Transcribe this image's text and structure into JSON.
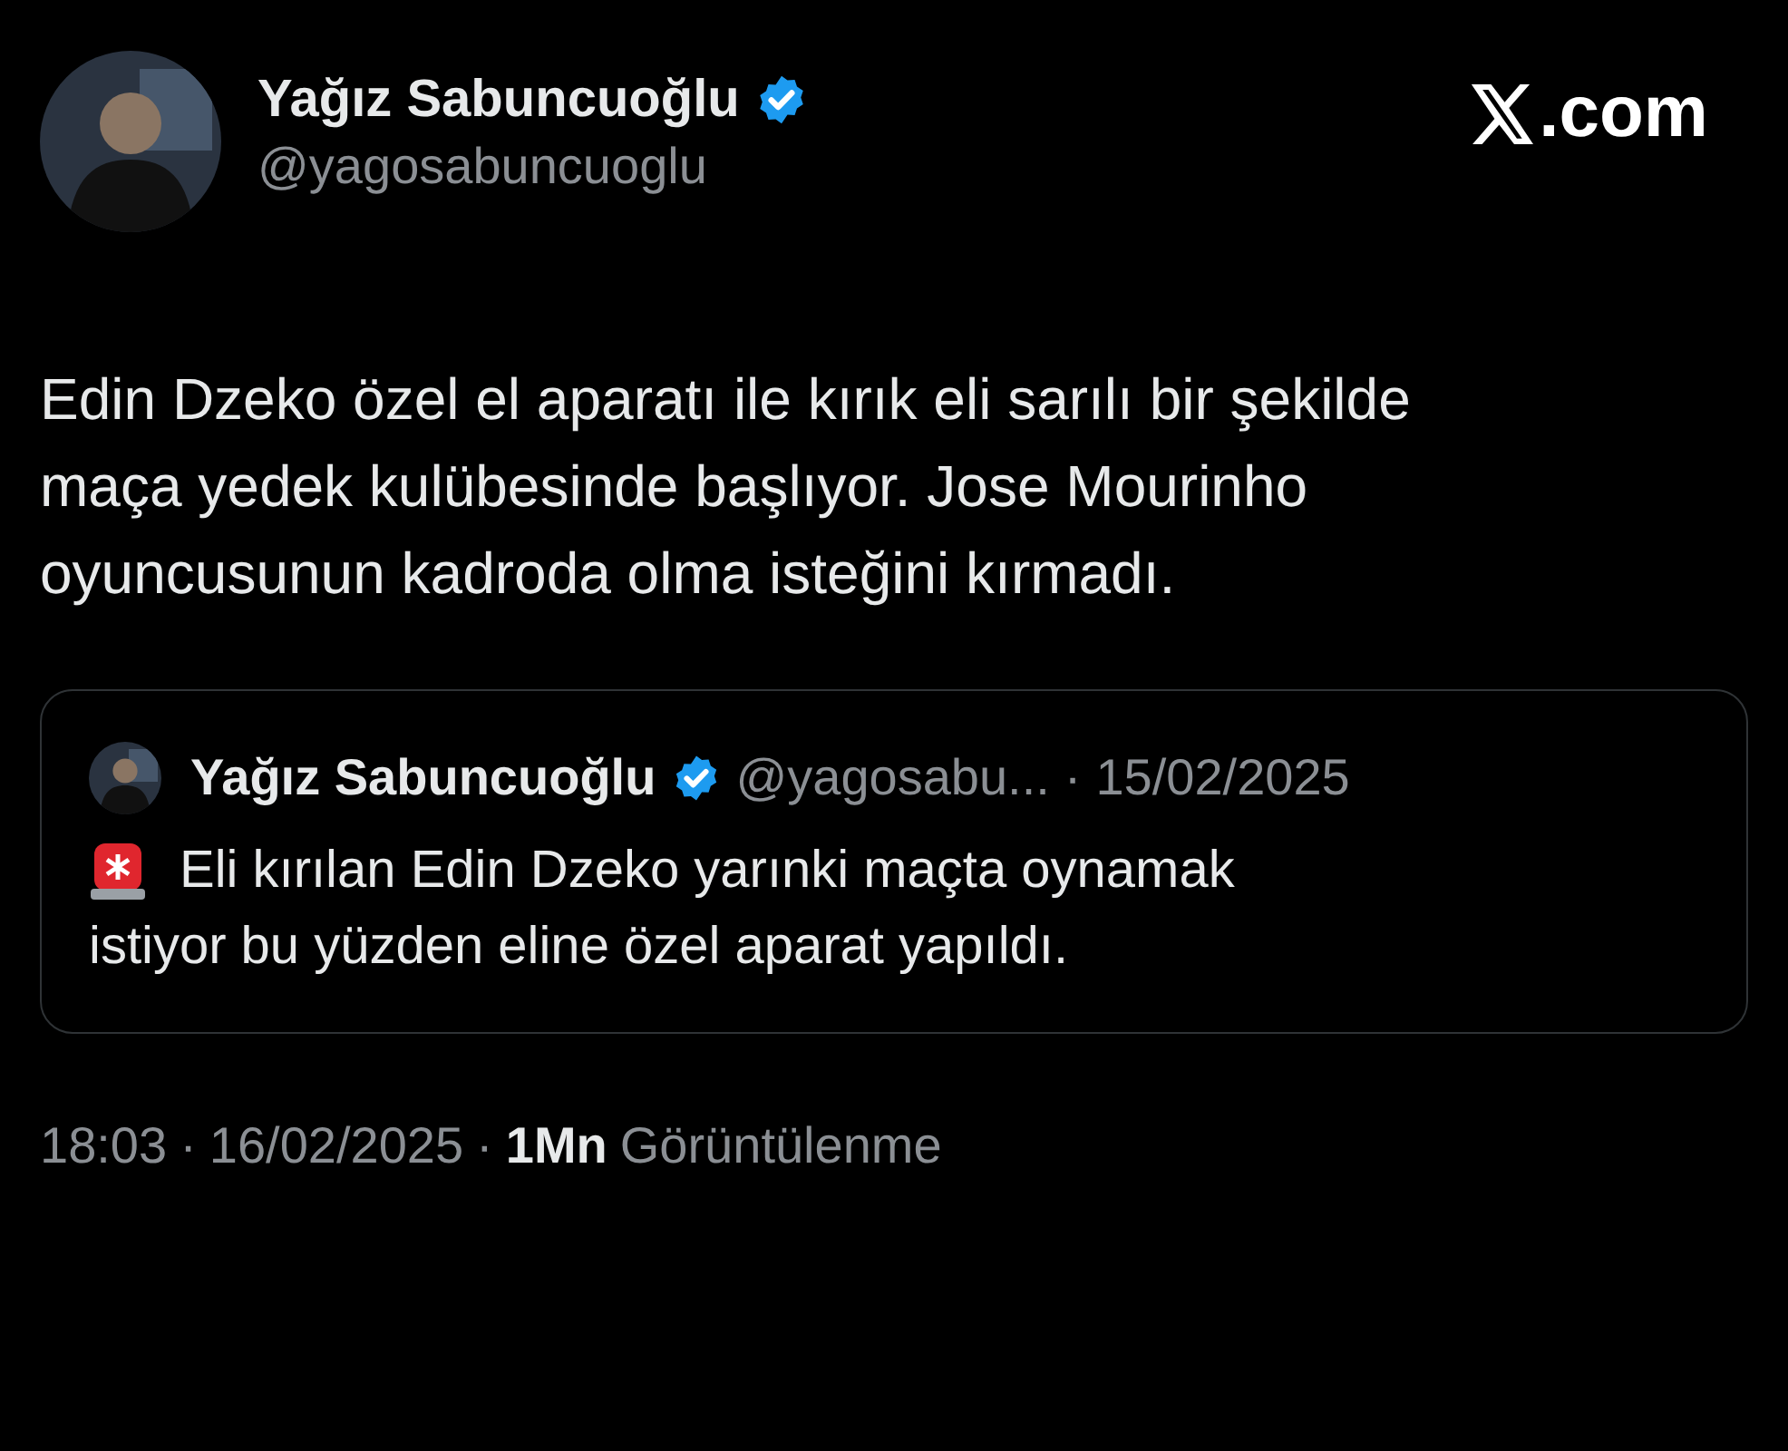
{
  "author": {
    "name": "Yağız Sabuncuoğlu",
    "handle": "@yagosabuncuoglu",
    "verified": true
  },
  "source_label": ".com",
  "text": "Edin Dzeko özel el aparatı ile kırık eli sarılı bir şekilde maça yedek kulübesinde başlıyor. Jose Mourinho oyuncusunun kadroda olma isteğini kırmadı.",
  "quoted": {
    "name": "Yağız Sabuncuoğlu",
    "verified": true,
    "handle": "@yagosabu...",
    "separator": "·",
    "date": "15/02/2025",
    "text_lines": [
      "Eli kırılan Edin Dzeko yarınki maçta oynamak",
      "istiyor bu yüzden eline özel aparat yapıldı."
    ]
  },
  "meta": {
    "time": "18:03",
    "separator_1": "·",
    "date": "16/02/2025",
    "separator_2": "·",
    "views_count": "1Mn",
    "views_label": "Görüntülenme"
  }
}
